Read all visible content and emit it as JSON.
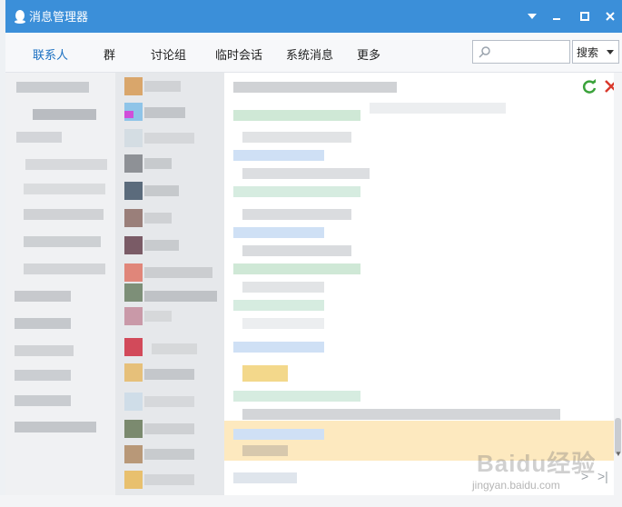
{
  "window": {
    "title": "消息管理器"
  },
  "tabs": [
    {
      "label": "联系人",
      "active": true
    },
    {
      "label": "群",
      "active": false
    },
    {
      "label": "讨论组",
      "active": false
    },
    {
      "label": "临时会话",
      "active": false
    },
    {
      "label": "系统消息",
      "active": false
    },
    {
      "label": "更多",
      "active": false
    }
  ],
  "search": {
    "placeholder": "",
    "button_label": "搜索"
  },
  "watermark": {
    "brand": "Baidu经验",
    "url": "jingyan.baidu.com"
  },
  "colors": {
    "titlebar": "#3b8fd9",
    "active_tab": "#1a6fc1",
    "highlight": "#fde9bf"
  },
  "icons": [
    "qq-penguin-icon",
    "menu-arrow-icon",
    "minimize-icon",
    "maximize-icon",
    "close-icon",
    "search-icon",
    "refresh-icon",
    "delete-icon",
    "next-page-icon",
    "last-page-icon"
  ]
}
